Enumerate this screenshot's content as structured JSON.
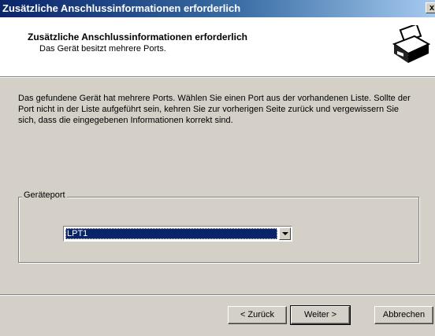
{
  "window": {
    "title": "Zusätzliche Anschlussinformationen erforderlich",
    "close_label": "x"
  },
  "header": {
    "title": "Zusätzliche Anschlussinformationen erforderlich",
    "subtitle": "Das Gerät besitzt mehrere Ports.",
    "icon": "printer-icon"
  },
  "body": {
    "intro": "Das gefundene Gerät hat mehrere Ports. Wählen Sie einen Port aus der vorhandenen Liste. Sollte der Port nicht in der Liste aufgeführt sein, kehren Sie zur vorherigen Seite zurück und vergewissern Sie sich, dass die eingegebenen Informationen korrekt sind."
  },
  "port_group": {
    "label": "Geräteport",
    "selected": "LPT1"
  },
  "buttons": {
    "back": "< Zurück",
    "next": "Weiter >",
    "cancel": "Abbrechen"
  }
}
